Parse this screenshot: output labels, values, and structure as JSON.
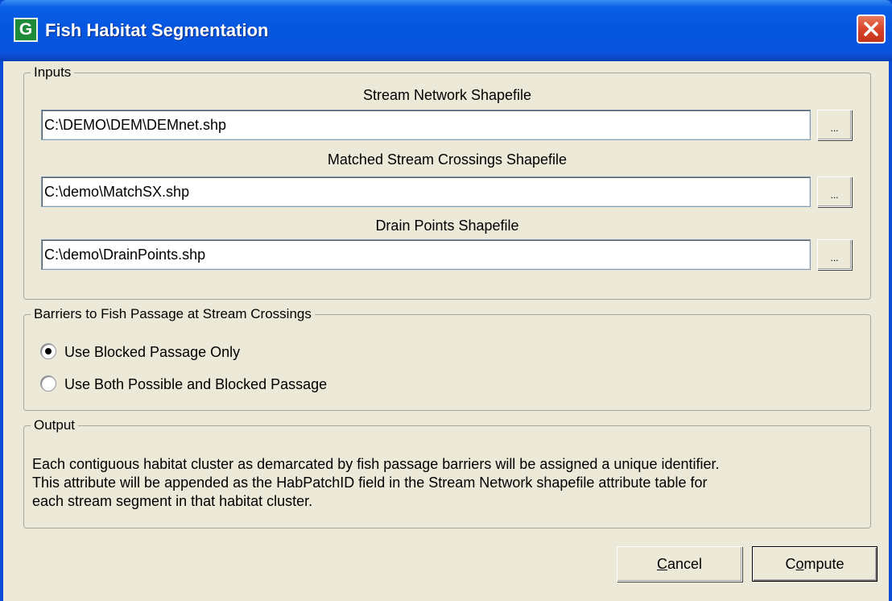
{
  "window": {
    "title": "Fish Habitat Segmentation",
    "icon_letter": "G"
  },
  "inputs": {
    "group_label": "Inputs",
    "stream_network": {
      "label": "Stream Network Shapefile",
      "value": "C:\\DEMO\\DEM\\DEMnet.shp",
      "browse_label": "..."
    },
    "matched_crossings": {
      "label": "Matched Stream Crossings Shapefile",
      "value": "C:\\demo\\MatchSX.shp",
      "browse_label": "..."
    },
    "drain_points": {
      "label": "Drain Points Shapefile",
      "value": "C:\\demo\\DrainPoints.shp",
      "browse_label": "..."
    }
  },
  "barriers": {
    "group_label": "Barriers to Fish Passage at Stream Crossings",
    "options": [
      {
        "label": "Use Blocked Passage Only",
        "selected": true
      },
      {
        "label": "Use Both Possible and Blocked Passage",
        "selected": false
      }
    ]
  },
  "output": {
    "group_label": "Output",
    "lines": [
      "Each contiguous habitat cluster as demarcated by fish passage barriers will be assigned a unique identifier.",
      "This attribute will be appended as the HabPatchID field in the Stream Network shapefile attribute table for",
      "each stream segment in that habitat cluster."
    ]
  },
  "buttons": {
    "cancel": {
      "mnemonic": "C",
      "rest": "ancel"
    },
    "compute": {
      "pre": "C",
      "mnemonic": "o",
      "rest": "mpute"
    }
  }
}
